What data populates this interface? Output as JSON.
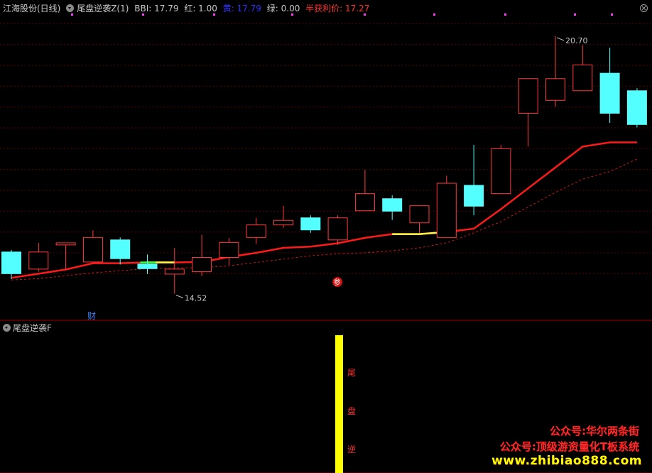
{
  "header": {
    "stock": "江海股份(日线)",
    "indicator": "尾盘逆袭Z(1)",
    "bbi": "BBI: 17.79",
    "red": "红: 1.00",
    "yellow": "黄: 17.79",
    "green": "绿: 0.00",
    "profit_price": "半获利价: 17.27",
    "colors": {
      "default": "#c8c8c8",
      "yellow_label": "#3030ff",
      "profit_label": "#ff3030"
    }
  },
  "sub_panel": {
    "title": "尾盘逆袭F",
    "signal_text": "尾盘逆"
  },
  "markers": {
    "finance": "财",
    "participate": "参"
  },
  "watermark": {
    "line1": "公众号:华尔两条街",
    "line2": "公众号:顶级游资量化T板系统",
    "line3": "www.zhibiao888.com"
  },
  "chart_data": {
    "type": "candlestick",
    "price_range": [
      14.0,
      21.5
    ],
    "grid": true,
    "candles": [
      {
        "open": 15.52,
        "close": 15.0,
        "high": 15.57,
        "low": 14.87
      },
      {
        "open": 15.11,
        "close": 15.52,
        "high": 15.74,
        "low": 15.05
      },
      {
        "open": 15.69,
        "close": 15.74,
        "high": 15.74,
        "low": 15.1
      },
      {
        "open": 15.28,
        "close": 15.87,
        "high": 16.04,
        "low": 15.28
      },
      {
        "open": 15.81,
        "close": 15.36,
        "high": 15.87,
        "low": 15.22
      },
      {
        "open": 15.23,
        "close": 15.12,
        "high": 15.46,
        "low": 14.99
      },
      {
        "open": 14.99,
        "close": 15.11,
        "high": 15.62,
        "low": 14.52
      },
      {
        "open": 15.05,
        "close": 15.39,
        "high": 15.93,
        "low": 14.94
      },
      {
        "open": 15.39,
        "close": 15.75,
        "high": 15.86,
        "low": 15.21
      },
      {
        "open": 15.87,
        "close": 16.17,
        "high": 16.34,
        "low": 15.71
      },
      {
        "open": 16.17,
        "close": 16.28,
        "high": 16.63,
        "low": 16.1
      },
      {
        "open": 16.34,
        "close": 16.05,
        "high": 16.4,
        "low": 15.98
      },
      {
        "open": 15.81,
        "close": 16.34,
        "high": 16.4,
        "low": 15.69
      },
      {
        "open": 16.51,
        "close": 16.92,
        "high": 17.49,
        "low": 16.51
      },
      {
        "open": 16.8,
        "close": 16.5,
        "high": 16.88,
        "low": 16.29
      },
      {
        "open": 16.22,
        "close": 16.63,
        "high": 16.63,
        "low": 15.98
      },
      {
        "open": 15.87,
        "close": 17.17,
        "high": 17.35,
        "low": 15.87
      },
      {
        "open": 17.12,
        "close": 16.62,
        "high": 18.09,
        "low": 16.4
      },
      {
        "open": 16.92,
        "close": 18.0,
        "high": 18.09,
        "low": 16.92
      },
      {
        "open": 18.85,
        "close": 19.68,
        "high": 19.68,
        "low": 18.05
      },
      {
        "open": 19.16,
        "close": 19.68,
        "high": 20.7,
        "low": 19.01
      },
      {
        "open": 19.39,
        "close": 20.01,
        "high": 20.48,
        "low": 19.39
      },
      {
        "open": 19.81,
        "close": 18.85,
        "high": 20.42,
        "low": 18.62
      },
      {
        "open": 19.39,
        "close": 18.58,
        "high": 19.45,
        "low": 18.51
      }
    ],
    "bbi_line": [
      14.9,
      15.0,
      15.1,
      15.25,
      15.25,
      15.27,
      15.27,
      15.28,
      15.4,
      15.5,
      15.62,
      15.65,
      15.73,
      15.86,
      15.95,
      15.95,
      16.0,
      16.08,
      16.55,
      17.05,
      17.55,
      18.05,
      18.15,
      18.15
    ],
    "profit_line": [
      14.85,
      14.88,
      14.95,
      15.02,
      15.07,
      15.12,
      15.14,
      15.14,
      15.19,
      15.27,
      15.35,
      15.43,
      15.48,
      15.5,
      15.55,
      15.62,
      15.74,
      15.98,
      16.25,
      16.6,
      16.95,
      17.27,
      17.45,
      17.75
    ],
    "bbi_yellow_segments": [
      [
        5,
        6
      ],
      [
        14,
        16
      ]
    ],
    "bbi_green_segments": [
      [
        5,
        6
      ]
    ],
    "annotations": [
      {
        "text": "20.70",
        "candle": 20,
        "price": 20.7
      },
      {
        "text": "14.52",
        "candle": 6,
        "price": 14.52
      }
    ],
    "signal_candle": 12
  }
}
